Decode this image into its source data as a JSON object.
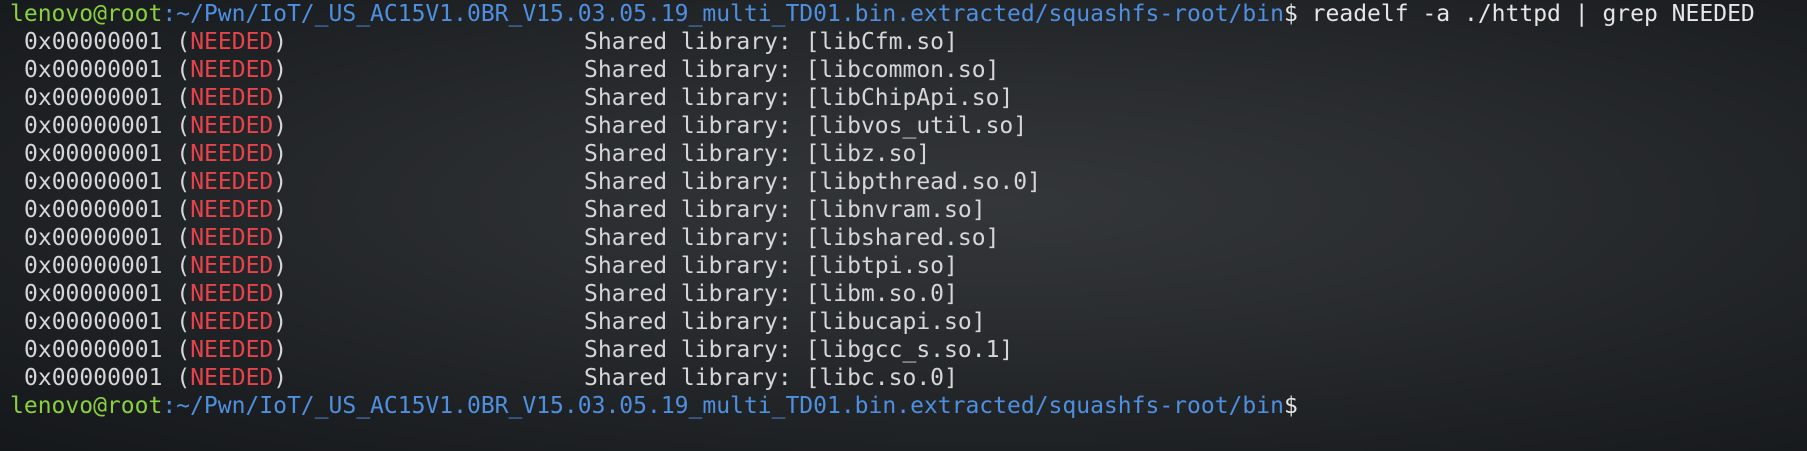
{
  "prompt": {
    "user_host": "lenovo@root",
    "path": ":~/Pwn/IoT/_US_AC15V1.0BR_V15.03.05.19_multi_TD01.bin.extracted/squashfs-root/bin",
    "dollar": "$",
    "command": " readelf -a ./httpd | grep NEEDED"
  },
  "output": {
    "tag_address": "0x00000001",
    "open_paren": " (",
    "needed_word": "NEEDED",
    "close_paren": ")",
    "lib_prefix": "Shared library: ",
    "libs": [
      "[libCfm.so]",
      "[libcommon.so]",
      "[libChipApi.so]",
      "[libvos_util.so]",
      "[libz.so]",
      "[libpthread.so.0]",
      "[libnvram.so]",
      "[libshared.so]",
      "[libtpi.so]",
      "[libm.so.0]",
      "[libucapi.so]",
      "[libgcc_s.so.1]",
      "[libc.so.0]"
    ]
  },
  "prompt2": {
    "user_host": "lenovo@root",
    "path": ":~/Pwn/IoT/_US_AC15V1.0BR_V15.03.05.19_multi_TD01.bin.extracted/squashfs-root/bin",
    "dollar": "$"
  },
  "colors": {
    "user": "#8ad13f",
    "path": "#4f8fe0",
    "needed": "#e8434b",
    "text": "#d6d6d6"
  }
}
